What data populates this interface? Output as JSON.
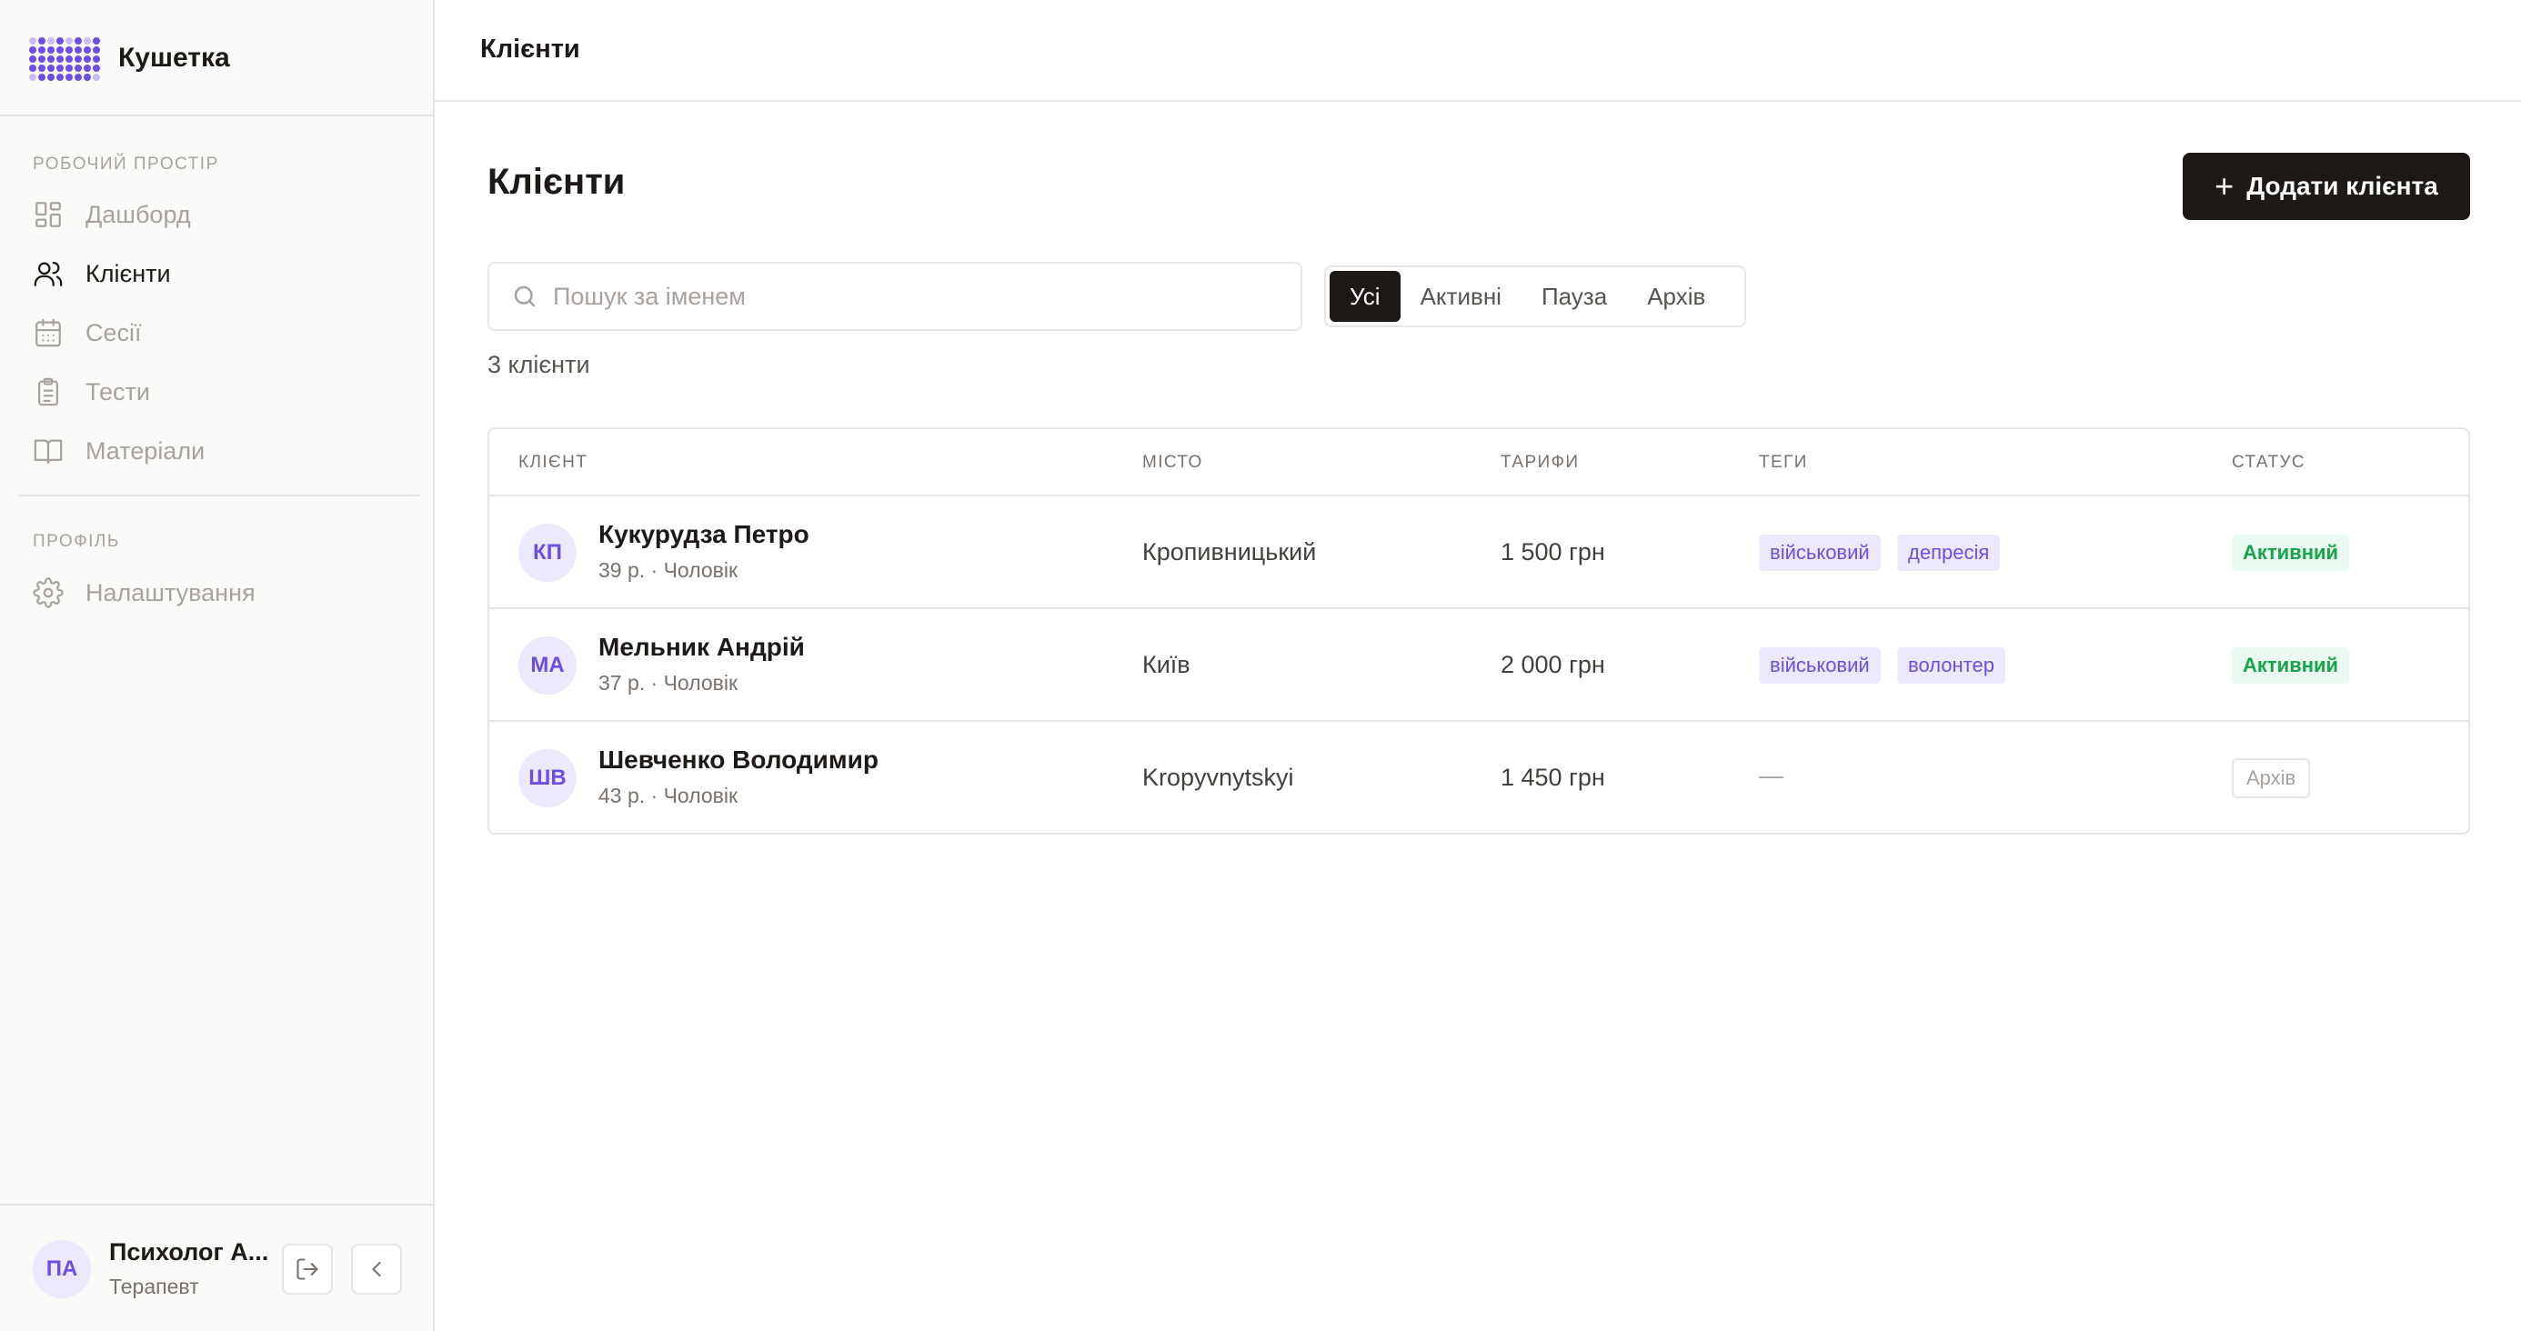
{
  "brand": {
    "name": "Кушетка"
  },
  "sidebar": {
    "workspace_label": "Робочий простір",
    "items": [
      {
        "label": "Дашборд",
        "icon": "dashboard-icon",
        "active": false
      },
      {
        "label": "Клієнти",
        "icon": "users-icon",
        "active": true
      },
      {
        "label": "Сесії",
        "icon": "calendar-icon",
        "active": false
      },
      {
        "label": "Тести",
        "icon": "clipboard-icon",
        "active": false
      },
      {
        "label": "Матеріали",
        "icon": "book-icon",
        "active": false
      }
    ],
    "profile_label": "Профіль",
    "profile_items": [
      {
        "label": "Налаштування",
        "icon": "gear-icon"
      }
    ]
  },
  "user": {
    "initials": "ПА",
    "name": "Психолог А...",
    "role": "Терапевт"
  },
  "topbar": {
    "title": "Клієнти"
  },
  "main": {
    "title": "Клієнти",
    "add_button": "Додати клієнта",
    "search_placeholder": "Пошук за іменем",
    "filters": [
      "Усі",
      "Активні",
      "Пауза",
      "Архів"
    ],
    "active_filter": "Усі",
    "count_text": "3 клієнти"
  },
  "table": {
    "columns": [
      "Клієнт",
      "Місто",
      "Тарифи",
      "Теги",
      "Статус"
    ],
    "rows": [
      {
        "initials": "КП",
        "name": "Кукурудза Петро",
        "meta": "39 р. · Чоловік",
        "city": "Кропивницький",
        "rate": "1 500 грн",
        "tags": [
          "військовий",
          "депресія"
        ],
        "status": "Активний",
        "status_type": "active"
      },
      {
        "initials": "МА",
        "name": "Мельник Андрій",
        "meta": "37 р. · Чоловік",
        "city": "Київ",
        "rate": "2 000 грн",
        "tags": [
          "військовий",
          "волонтер"
        ],
        "status": "Активний",
        "status_type": "active"
      },
      {
        "initials": "ШВ",
        "name": "Шевченко Володимир",
        "meta": "43 р. · Чоловік",
        "city": "Kropyvnytskyi",
        "rate": "1 450 грн",
        "tags_empty": "—",
        "status": "Архів",
        "status_type": "archive"
      }
    ]
  },
  "colors": {
    "accent": "#6d4de6",
    "accent_soft": "#ede9fc",
    "primary_dark": "#1c1917",
    "status_green": "#16a34a",
    "status_green_bg": "#eafaf0"
  }
}
